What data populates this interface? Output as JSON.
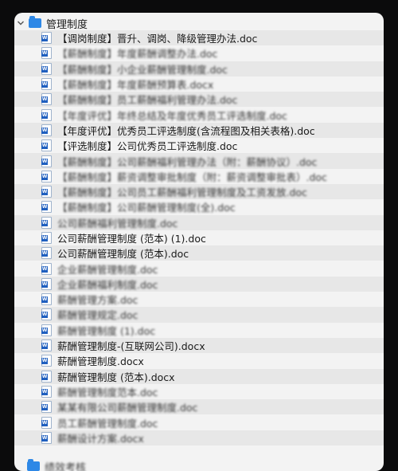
{
  "folder": {
    "name": "管理制度",
    "expanded": true
  },
  "files": [
    {
      "name": "【调岗制度】晋升、调岗、降级管理办法.doc",
      "obscured": false
    },
    {
      "name": "【薪酬制度】年度薪酬调整办法.doc",
      "obscured": true
    },
    {
      "name": "【薪酬制度】小企业薪酬管理制度.doc",
      "obscured": true
    },
    {
      "name": "【薪酬制度】年度薪酬预算表.docx",
      "obscured": true
    },
    {
      "name": "【薪酬制度】员工薪酬福利管理办法.doc",
      "obscured": true
    },
    {
      "name": "【年度评优】年终总结及年度优秀员工评选制度.doc",
      "obscured": true
    },
    {
      "name": "【年度评优】优秀员工评选制度(含流程图及相关表格).doc",
      "obscured": false
    },
    {
      "name": "【评选制度】公司优秀员工评选制度.doc",
      "obscured": false
    },
    {
      "name": "【薪酬制度】公司薪酬福利管理办法（附：薪酬协议）.doc",
      "obscured": true
    },
    {
      "name": "【薪酬制度】薪资调整审批制度（附：薪资调整审批表）.doc",
      "obscured": true
    },
    {
      "name": "【薪酬制度】公司员工薪酬福利管理制度及工资发放.doc",
      "obscured": true
    },
    {
      "name": "【薪酬制度】公司薪酬管理制度(全).doc",
      "obscured": true
    },
    {
      "name": "公司薪酬福利管理制度.doc",
      "obscured": true
    },
    {
      "name": "公司薪酬管理制度 (范本) (1).doc",
      "obscured": false
    },
    {
      "name": "公司薪酬管理制度 (范本).doc",
      "obscured": false
    },
    {
      "name": "企业薪酬管理制度.doc",
      "obscured": true
    },
    {
      "name": "企业薪酬福利制度.doc",
      "obscured": true
    },
    {
      "name": "薪酬管理方案.doc",
      "obscured": true
    },
    {
      "name": "薪酬管理规定.doc",
      "obscured": true
    },
    {
      "name": "薪酬管理制度 (1).doc",
      "obscured": true
    },
    {
      "name": "薪酬管理制度-(互联网公司).docx",
      "obscured": false
    },
    {
      "name": "薪酬管理制度.docx",
      "obscured": false
    },
    {
      "name": "薪酬管理制度 (范本).docx",
      "obscured": false
    },
    {
      "name": "薪酬管理制度范本.doc",
      "obscured": true
    },
    {
      "name": "某某有限公司薪酬管理制度.doc",
      "obscured": true
    },
    {
      "name": "员工薪酬管理制度.doc",
      "obscured": true
    },
    {
      "name": "薪酬设计方案.docx",
      "obscured": true
    }
  ],
  "next_folder": {
    "name": "绩效考核"
  }
}
